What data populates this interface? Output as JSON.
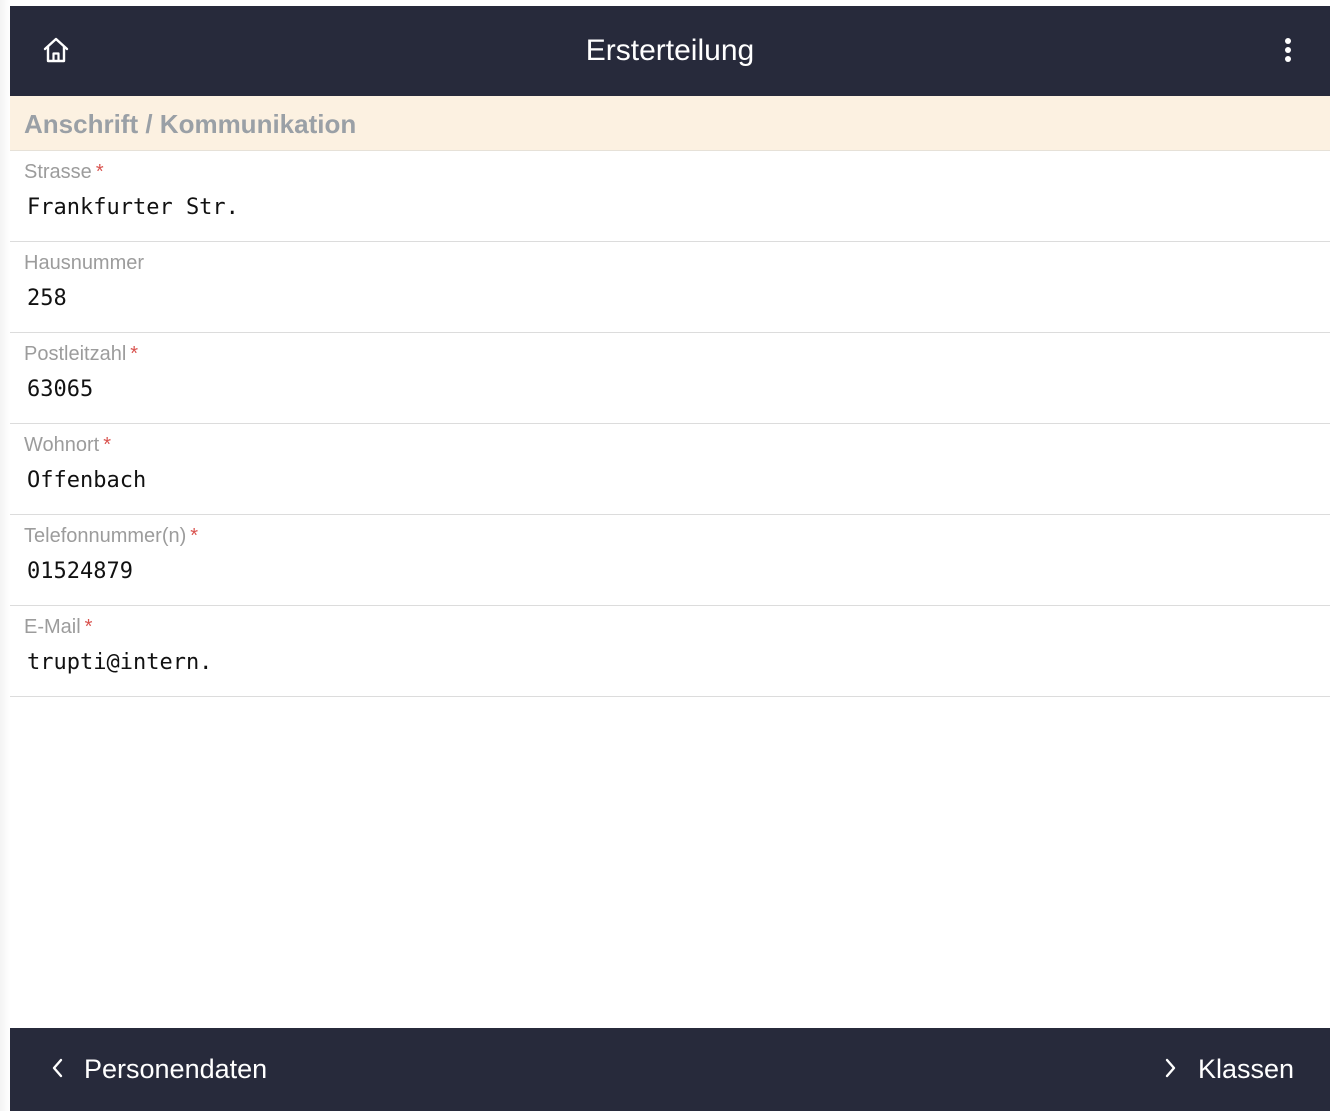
{
  "header": {
    "title": "Ersterteilung",
    "home_icon": "home-icon",
    "menu_icon": "more-vertical-icon"
  },
  "section": {
    "title": "Anschrift / Kommunikation"
  },
  "fields": [
    {
      "label": "Strasse",
      "required": "*",
      "value": "Frankfurter Str."
    },
    {
      "label": "Hausnummer",
      "required": "",
      "value": "258"
    },
    {
      "label": "Postleitzahl",
      "required": "*",
      "value": "63065"
    },
    {
      "label": "Wohnort",
      "required": "*",
      "value": "Offenbach"
    },
    {
      "label": "Telefonnummer(n)",
      "required": "*",
      "value": "01524879"
    },
    {
      "label": "E-Mail",
      "required": "*",
      "value": "trupti@intern."
    }
  ],
  "footer": {
    "back_label": "Personendaten",
    "next_label": "Klassen",
    "back_icon": "chevron-left-icon",
    "next_icon": "chevron-right-icon"
  },
  "colors": {
    "bar_background": "#272a3b",
    "section_background": "#fcf1e1",
    "required_marker": "#d9534f"
  }
}
